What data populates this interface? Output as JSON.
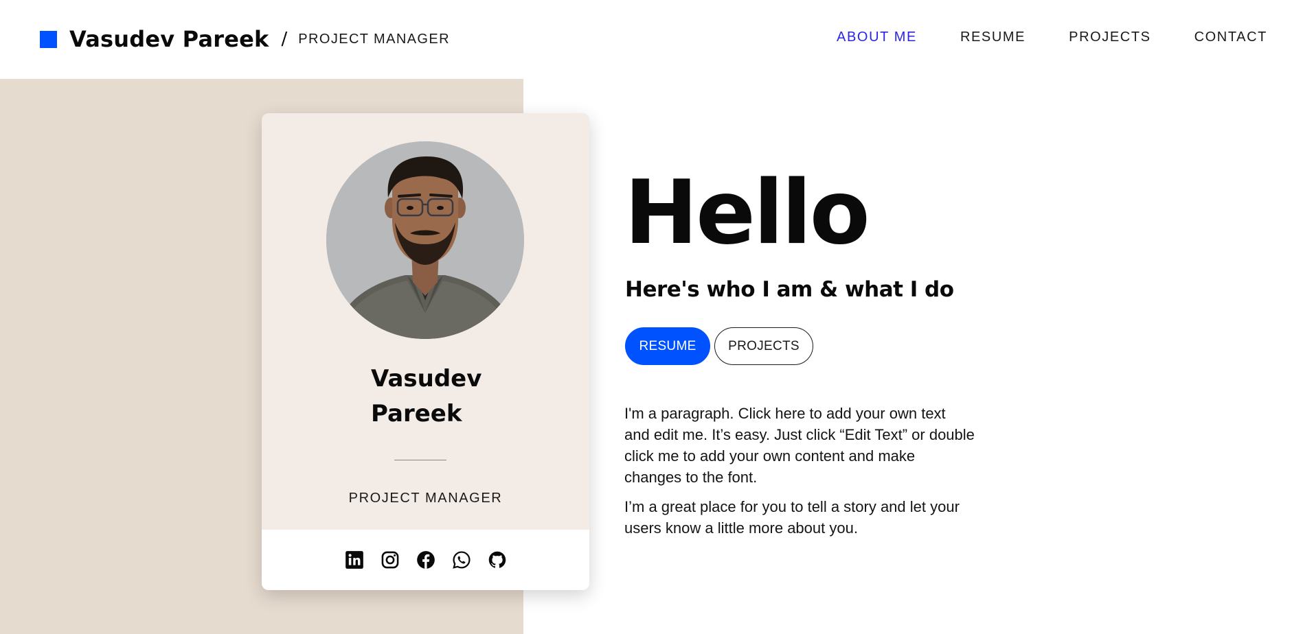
{
  "header": {
    "brand_name": "Vasudev Pareek",
    "separator": "/",
    "brand_role": "PROJECT MANAGER",
    "nav": [
      {
        "label": "ABOUT ME",
        "active": true
      },
      {
        "label": "RESUME",
        "active": false
      },
      {
        "label": "PROJECTS",
        "active": false
      },
      {
        "label": "CONTACT",
        "active": false
      }
    ]
  },
  "card": {
    "avatar_icon": "profile-photo",
    "name": "Vasudev Pareek",
    "role": "PROJECT MANAGER",
    "social_icons": [
      "linkedin-icon",
      "instagram-icon",
      "facebook-icon",
      "whatsapp-icon",
      "github-icon"
    ]
  },
  "hero": {
    "title": "Hello",
    "subtitle": "Here's who I am & what I do",
    "buttons": {
      "resume_label": "RESUME",
      "projects_label": "PROJECTS"
    },
    "paragraphs": [
      "I'm a paragraph. Click here to add your own text and edit me. It’s easy. Just click “Edit Text” or double click me to add your own content and make changes to the font.",
      "I’m a great place for you to tell a story and let your users know a little more about you."
    ]
  },
  "colors": {
    "accent": "#0052ff",
    "nav_active": "#2a24e6",
    "beige_panel": "#e6dbcf",
    "card_bg": "#f3ece6"
  }
}
